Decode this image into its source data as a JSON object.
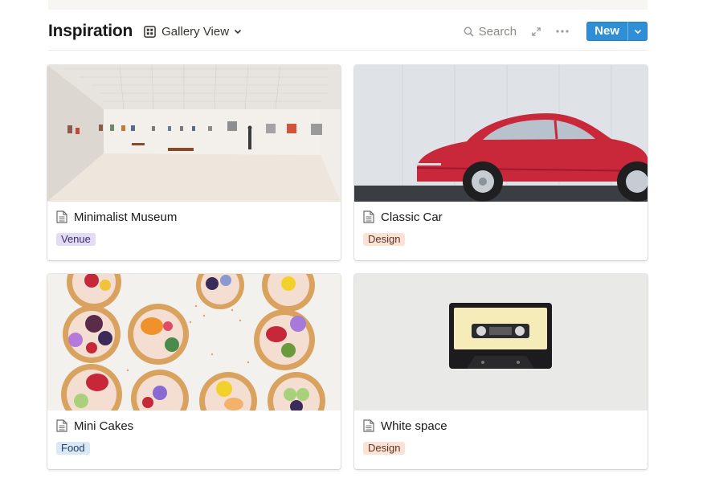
{
  "header": {
    "title": "Inspiration",
    "view_label": "Gallery View",
    "search_label": "Search",
    "new_label": "New"
  },
  "cards": [
    {
      "title": "Minimalist Museum",
      "tag": "Venue",
      "tag_bg": "#e3dcf5",
      "tag_fg": "#3f2c6b"
    },
    {
      "title": "Classic Car",
      "tag": "Design",
      "tag_bg": "#fbe2d5",
      "tag_fg": "#5a3626"
    },
    {
      "title": "Mini Cakes",
      "tag": "Food",
      "tag_bg": "#d9e8f7",
      "tag_fg": "#1f3b57"
    },
    {
      "title": "White space",
      "tag": "Design",
      "tag_bg": "#fbe2d5",
      "tag_fg": "#5a3626"
    }
  ],
  "colors": {
    "accent": "#2e8fd6"
  },
  "icons": [
    "gallery-grid-icon",
    "chevron-down-icon",
    "search-icon",
    "expand-icon",
    "more-icon",
    "page-icon"
  ]
}
